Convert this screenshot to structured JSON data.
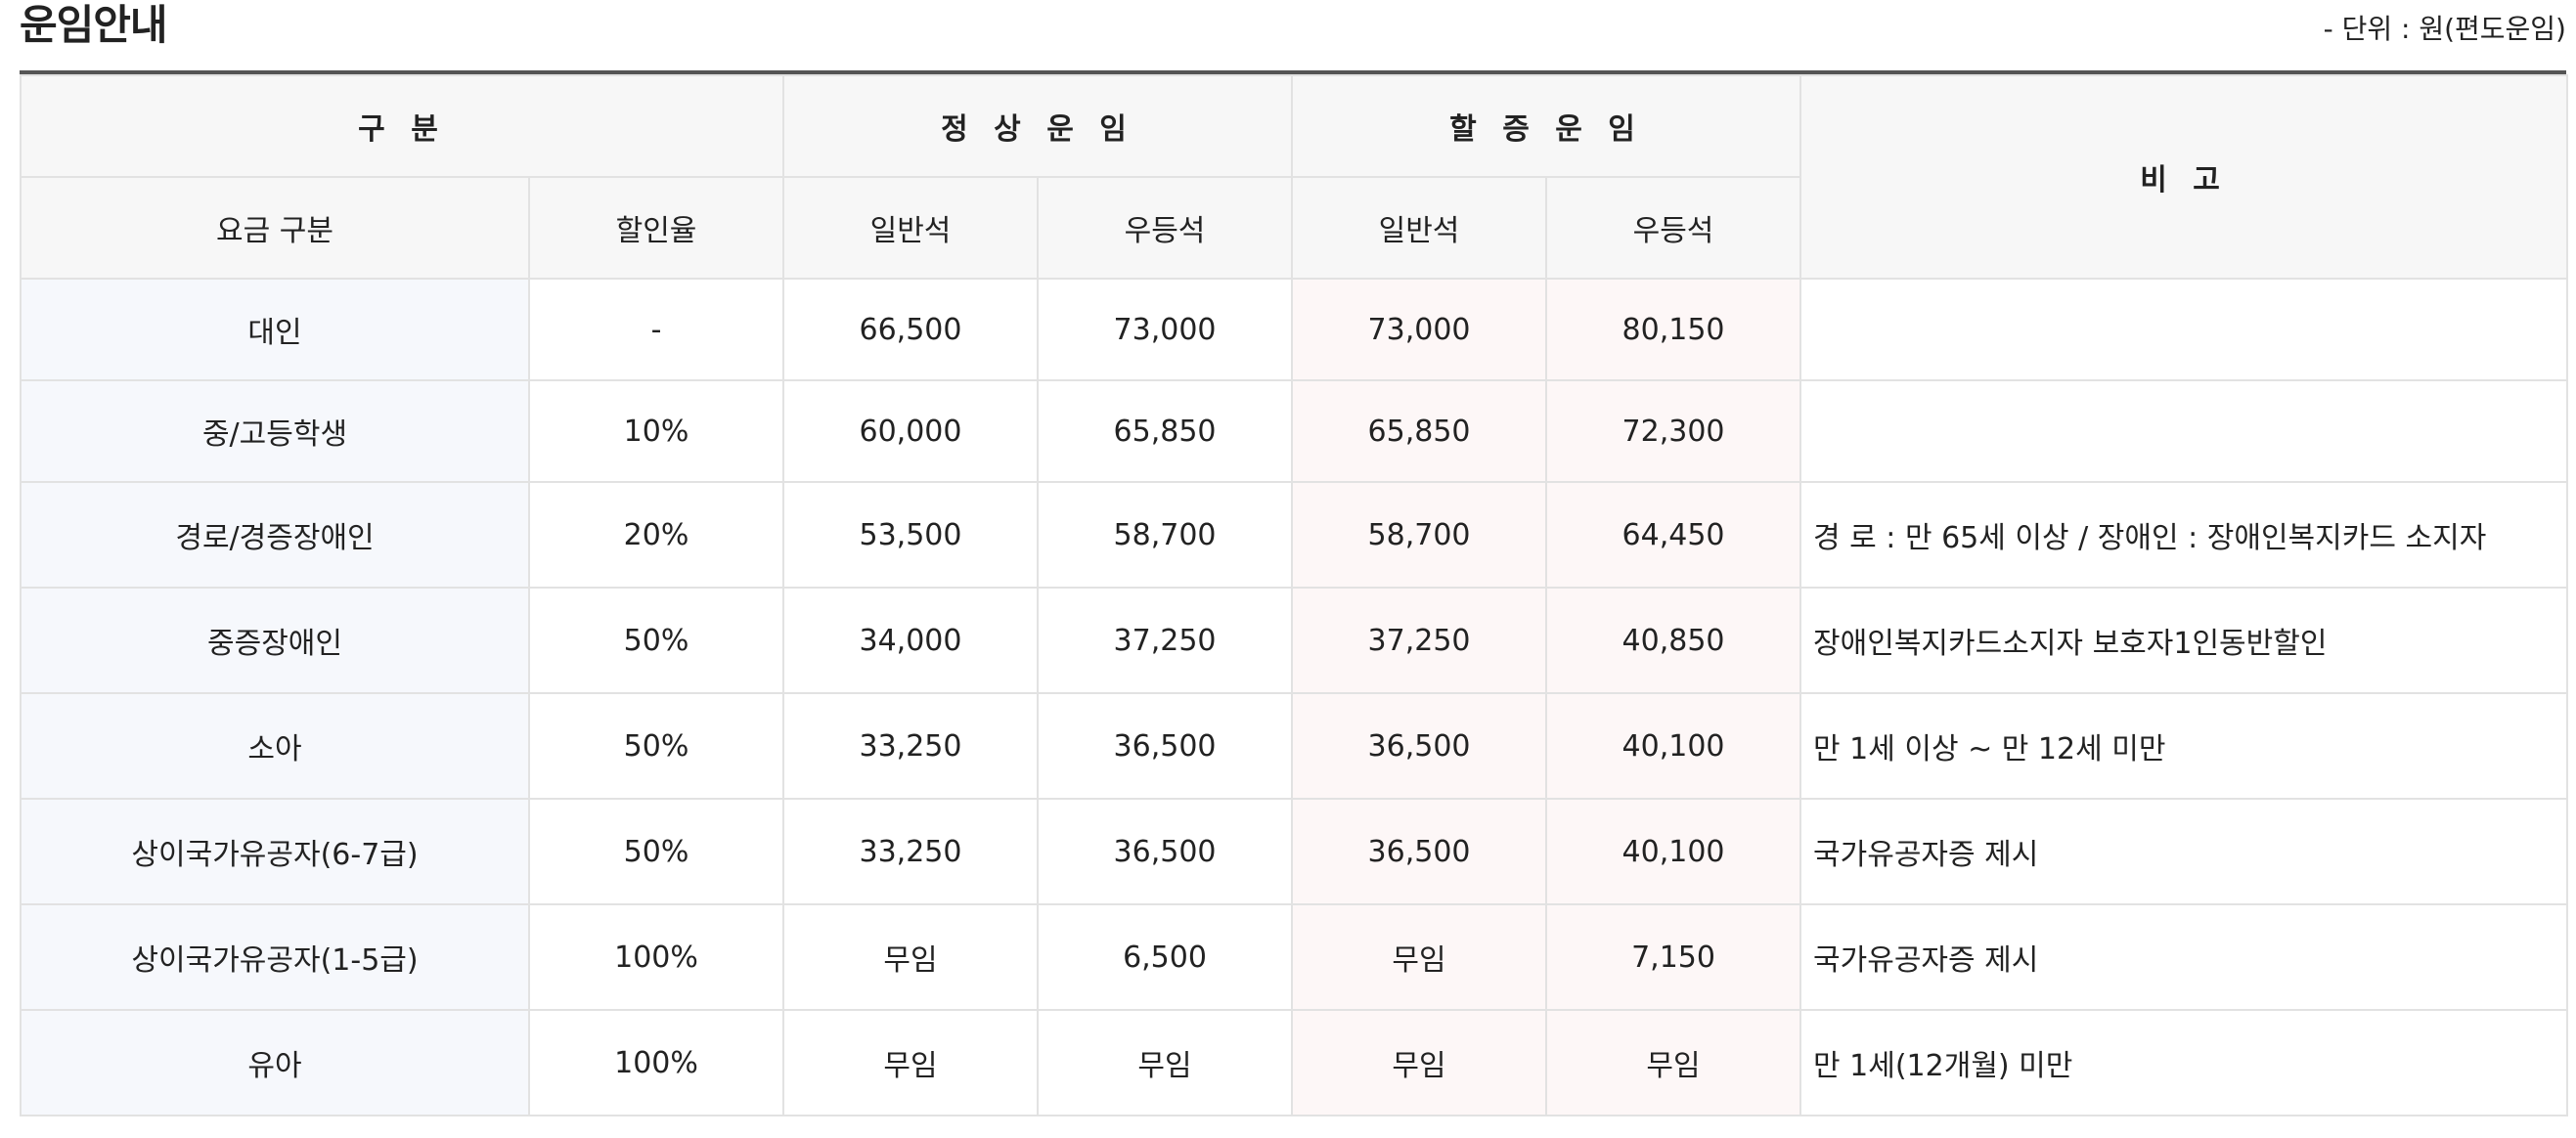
{
  "page": {
    "title": "운임안내",
    "unit_note": "- 단위 : 원(편도운임)"
  },
  "table": {
    "group_headers": {
      "category": "구 분",
      "normal": "정 상 운 임",
      "surcharge": "할 증 운 임",
      "note": "비 고"
    },
    "sub_headers": {
      "fare_type": "요금 구분",
      "discount": "할인율",
      "normal_general": "일반석",
      "normal_premium": "우등석",
      "surcharge_general": "일반석",
      "surcharge_premium": "우등석"
    },
    "rows": [
      {
        "type": "대인",
        "discount": "-",
        "normal_general": "66,500",
        "normal_premium": "73,000",
        "surcharge_general": "73,000",
        "surcharge_premium": "80,150",
        "note": ""
      },
      {
        "type": "중/고등학생",
        "discount": "10%",
        "normal_general": "60,000",
        "normal_premium": "65,850",
        "surcharge_general": "65,850",
        "surcharge_premium": "72,300",
        "note": ""
      },
      {
        "type": "경로/경증장애인",
        "discount": "20%",
        "normal_general": "53,500",
        "normal_premium": "58,700",
        "surcharge_general": "58,700",
        "surcharge_premium": "64,450",
        "note": "경 로 : 만 65세 이상 / 장애인 : 장애인복지카드 소지자"
      },
      {
        "type": "중증장애인",
        "discount": "50%",
        "normal_general": "34,000",
        "normal_premium": "37,250",
        "surcharge_general": "37,250",
        "surcharge_premium": "40,850",
        "note": "장애인복지카드소지자 보호자1인동반할인"
      },
      {
        "type": "소아",
        "discount": "50%",
        "normal_general": "33,250",
        "normal_premium": "36,500",
        "surcharge_general": "36,500",
        "surcharge_premium": "40,100",
        "note": "만 1세 이상 ~ 만 12세 미만"
      },
      {
        "type": "상이국가유공자(6-7급)",
        "discount": "50%",
        "normal_general": "33,250",
        "normal_premium": "36,500",
        "surcharge_general": "36,500",
        "surcharge_premium": "40,100",
        "note": "국가유공자증 제시"
      },
      {
        "type": "상이국가유공자(1-5급)",
        "discount": "100%",
        "normal_general": "무임",
        "normal_premium": "6,500",
        "surcharge_general": "무임",
        "surcharge_premium": "7,150",
        "note": "국가유공자증 제시"
      },
      {
        "type": "유아",
        "discount": "100%",
        "normal_general": "무임",
        "normal_premium": "무임",
        "surcharge_general": "무임",
        "surcharge_premium": "무임",
        "note": "만 1세(12개월) 미만"
      }
    ]
  }
}
